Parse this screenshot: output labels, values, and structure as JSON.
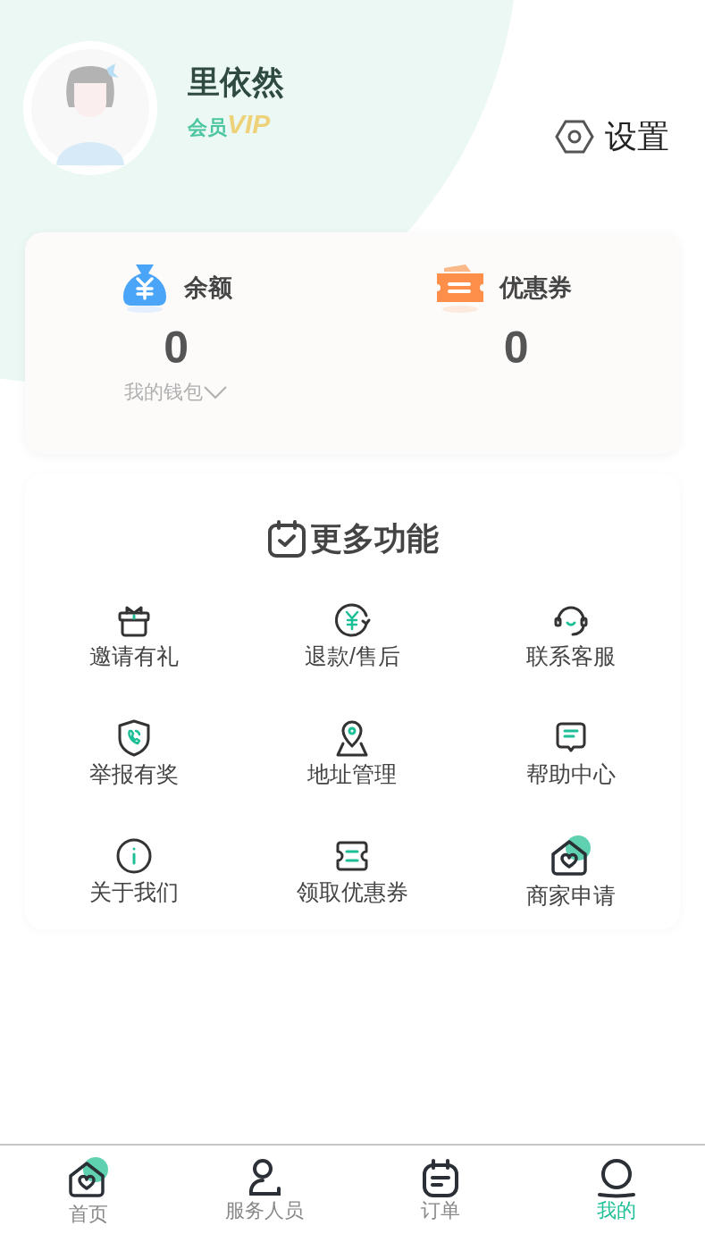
{
  "profile": {
    "name": "里依然",
    "member_label": "会员",
    "member_tier": "VIP"
  },
  "settings": {
    "label": "设置"
  },
  "wallet": [
    {
      "label": "余额",
      "value": "0",
      "link": "我的钱包"
    },
    {
      "label": "优惠券",
      "value": "0"
    }
  ],
  "features": {
    "title": "更多功能",
    "items": [
      {
        "label": "邀请有礼"
      },
      {
        "label": "退款/售后"
      },
      {
        "label": "联系客服"
      },
      {
        "label": "举报有奖"
      },
      {
        "label": "地址管理"
      },
      {
        "label": "帮助中心"
      },
      {
        "label": "关于我们"
      },
      {
        "label": "领取优惠券"
      },
      {
        "label": "商家申请"
      }
    ]
  },
  "tabs": [
    {
      "label": "首页",
      "selected": false
    },
    {
      "label": "服务人员",
      "selected": false
    },
    {
      "label": "订单",
      "selected": false
    },
    {
      "label": "我的",
      "selected": true
    }
  ]
}
